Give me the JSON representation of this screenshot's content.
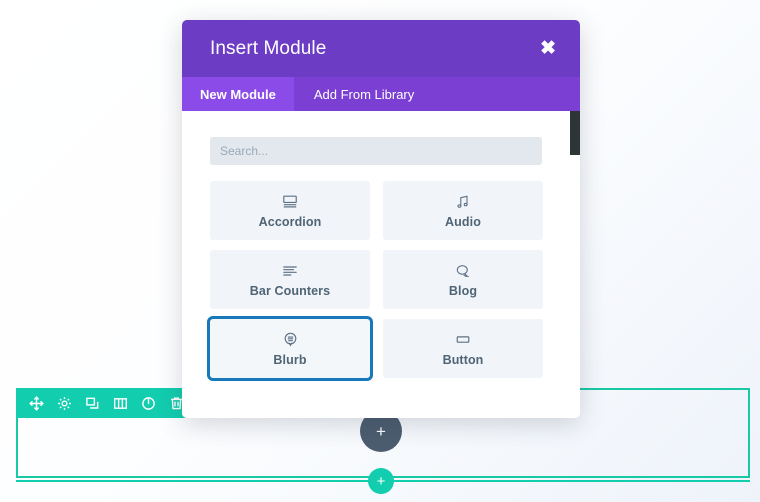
{
  "modal": {
    "title": "Insert Module",
    "close_label": "✖",
    "tabs": [
      {
        "label": "New Module",
        "active": true
      },
      {
        "label": "Add From Library",
        "active": false
      }
    ],
    "search": {
      "value": "",
      "placeholder": "Search..."
    },
    "modules": [
      {
        "label": "Accordion",
        "icon": "accordion-icon",
        "selected": false
      },
      {
        "label": "Audio",
        "icon": "audio-icon",
        "selected": false
      },
      {
        "label": "Bar Counters",
        "icon": "bar-counters-icon",
        "selected": false
      },
      {
        "label": "Blog",
        "icon": "blog-icon",
        "selected": false
      },
      {
        "label": "Blurb",
        "icon": "blurb-icon",
        "selected": true
      },
      {
        "label": "Button",
        "icon": "button-icon",
        "selected": false
      }
    ],
    "colors": {
      "header": "#6c3cc4",
      "tab_bar": "#7b3fd4",
      "tab_active": "#8b4be8",
      "tile_bg": "#f1f4f8",
      "selection_outline": "#1779ba",
      "scrollbar_thumb": "#2e3538"
    }
  },
  "builder": {
    "section_border_color": "#19c8a5",
    "toolbar_color": "#12cdae",
    "toolbar_icons": [
      {
        "name": "move-icon",
        "title": "Move"
      },
      {
        "name": "gear-icon",
        "title": "Settings"
      },
      {
        "name": "duplicate-icon",
        "title": "Duplicate"
      },
      {
        "name": "columns-icon",
        "title": "Columns"
      },
      {
        "name": "power-icon",
        "title": "Disable"
      },
      {
        "name": "trash-icon",
        "title": "Delete"
      }
    ],
    "add_module_label": "+",
    "add_row_label": "+",
    "add_module_color": "#4c5d70",
    "add_row_color": "#12cdae"
  }
}
